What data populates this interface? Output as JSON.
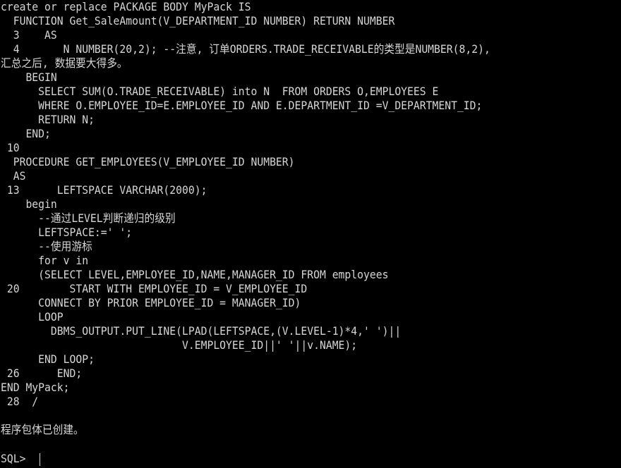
{
  "terminal": {
    "lines": [
      "create or replace PACKAGE BODY MyPack IS",
      "  FUNCTION Get_SaleAmount(V_DEPARTMENT_ID NUMBER) RETURN NUMBER",
      "  3    AS",
      "  4       N NUMBER(20,2); --注意, 订单ORDERS.TRADE_RECEIVABLE的类型是NUMBER(8,2),",
      "汇总之后, 数据要大得多。",
      "    BEGIN",
      "      SELECT SUM(O.TRADE_RECEIVABLE) into N  FROM ORDERS O,EMPLOYEES E",
      "      WHERE O.EMPLOYEE_ID=E.EMPLOYEE_ID AND E.DEPARTMENT_ID =V_DEPARTMENT_ID;",
      "      RETURN N;",
      "    END;",
      " 10",
      "  PROCEDURE GET_EMPLOYEES(V_EMPLOYEE_ID NUMBER)",
      "  AS",
      " 13      LEFTSPACE VARCHAR(2000);",
      "    begin",
      "      --通过LEVEL判断递归的级别",
      "      LEFTSPACE:=' ';",
      "      --使用游标",
      "      for v in",
      "      (SELECT LEVEL,EMPLOYEE_ID,NAME,MANAGER_ID FROM employees",
      " 20        START WITH EMPLOYEE_ID = V_EMPLOYEE_ID",
      "      CONNECT BY PRIOR EMPLOYEE_ID = MANAGER_ID)",
      "      LOOP",
      "        DBMS_OUTPUT.PUT_LINE(LPAD(LEFTSPACE,(V.LEVEL-1)*4,' ')||",
      "                             V.EMPLOYEE_ID||' '||v.NAME);",
      "      END LOOP;",
      " 26      END;",
      "END MyPack;",
      " 28  /",
      "",
      "程序包体已创建。",
      "",
      "SQL> "
    ]
  },
  "colors": {
    "background": "#000000",
    "text": "#d6d6d6"
  }
}
